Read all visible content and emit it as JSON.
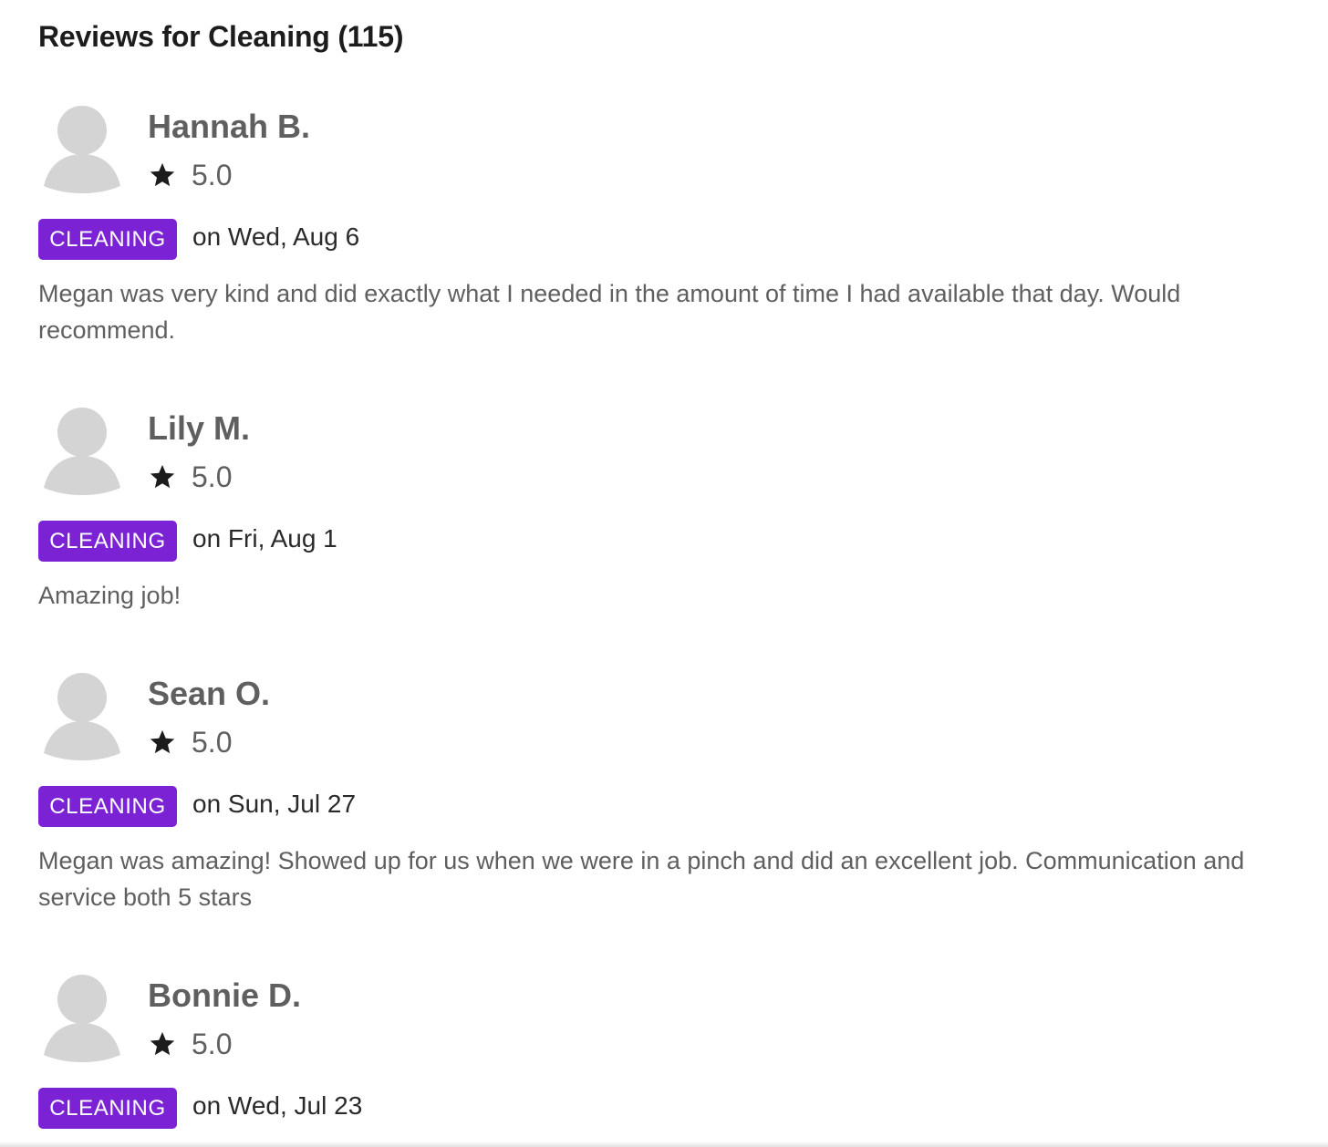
{
  "header": {
    "title": "Reviews for Cleaning (115)"
  },
  "reviews": [
    {
      "name": "Hannah B.",
      "rating": "5.0",
      "category": "CLEANING",
      "date": "on Wed, Aug 6",
      "text": "Megan was very kind and did exactly what I needed in the amount of time I had available that day. Would recommend."
    },
    {
      "name": "Lily M.",
      "rating": "5.0",
      "category": "CLEANING",
      "date": "on Fri, Aug 1",
      "text": "Amazing job!"
    },
    {
      "name": "Sean O.",
      "rating": "5.0",
      "category": "CLEANING",
      "date": "on Sun, Jul 27",
      "text": "Megan was amazing! Showed up for us when we were in a pinch and did an excellent job. Communication and service both 5 stars"
    },
    {
      "name": "Bonnie D.",
      "rating": "5.0",
      "category": "CLEANING",
      "date": "on Wed, Jul 23",
      "text": ""
    }
  ],
  "icons": {
    "avatar": "default-avatar-icon",
    "star": "star-icon"
  },
  "colors": {
    "badge_background": "#7b22d4",
    "badge_text": "#ffffff",
    "heading": "#1c1c1c",
    "body_text": "#5f5f5f",
    "avatar": "#d4d4d4",
    "star": "#1c1c1c"
  }
}
